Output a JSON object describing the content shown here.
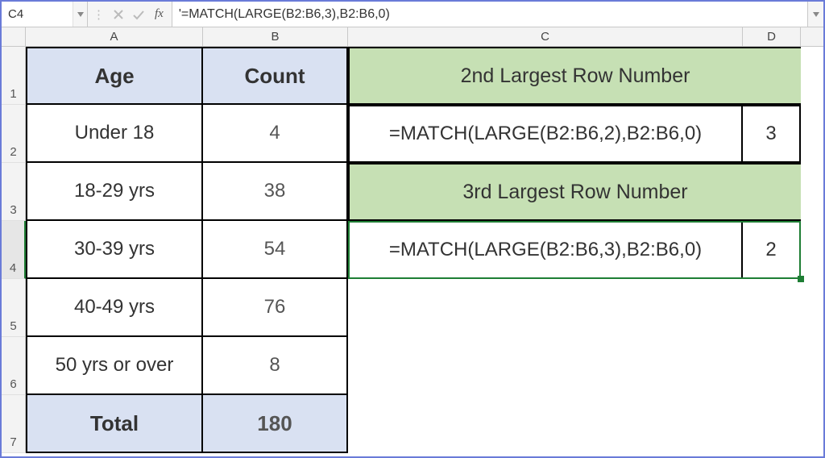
{
  "formula_bar": {
    "cell_ref": "C4",
    "fx_label": "fx",
    "formula": "'=MATCH(LARGE(B2:B6,3),B2:B6,0)"
  },
  "columns": {
    "A": "A",
    "B": "B",
    "C": "C",
    "D": "D"
  },
  "row_numbers": [
    "1",
    "2",
    "3",
    "4",
    "5",
    "6",
    "7"
  ],
  "table": {
    "header": {
      "age": "Age",
      "count": "Count"
    },
    "rows": [
      {
        "age": "Under 18",
        "count": "4"
      },
      {
        "age": "18-29 yrs",
        "count": "38"
      },
      {
        "age": "30-39 yrs",
        "count": "54"
      },
      {
        "age": "40-49 yrs",
        "count": "76"
      },
      {
        "age": "50 yrs or over",
        "count": "8"
      }
    ],
    "total": {
      "label": "Total",
      "value": "180"
    }
  },
  "right": {
    "header1": "2nd Largest Row Number",
    "formula1": "=MATCH(LARGE(B2:B6,2),B2:B6,0)",
    "result1": "3",
    "header2": "3rd Largest Row Number",
    "formula2": "=MATCH(LARGE(B2:B6,3),B2:B6,0)",
    "result2": "2"
  }
}
